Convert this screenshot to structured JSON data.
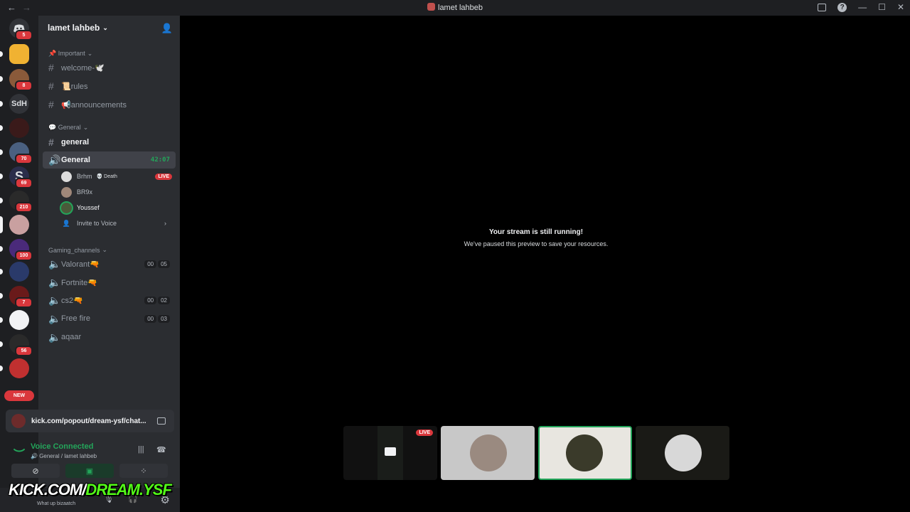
{
  "window": {
    "title": "lamet lahbeb",
    "back": "←",
    "forward": "→",
    "minimize": "—",
    "maximize": "☐",
    "close": "✕"
  },
  "rail": {
    "home_badge": "5",
    "servers": [
      {
        "label": "",
        "badge": "",
        "color": "#f0b232"
      },
      {
        "label": "",
        "badge": "8",
        "color": "#8a5a3a"
      },
      {
        "label": "SdH",
        "badge": "",
        "color": "#313338"
      },
      {
        "label": "",
        "badge": "",
        "color": "#3a1a1a"
      },
      {
        "label": "",
        "badge": "70",
        "color": "#4a6080"
      },
      {
        "label": "S",
        "badge": "69",
        "color": "#2b2d4a"
      },
      {
        "label": "",
        "badge": "210",
        "color": "#2a2a2a"
      },
      {
        "label": "",
        "badge": "",
        "color": "#c9a0a0"
      },
      {
        "label": "",
        "badge": "100",
        "color": "#4a2a7a"
      },
      {
        "label": "",
        "badge": "",
        "color": "#2a3a6a"
      },
      {
        "label": "",
        "badge": "7",
        "color": "#6a1a1a"
      },
      {
        "label": "",
        "badge": "",
        "color": "#f2f3f5"
      },
      {
        "label": "",
        "badge": "56",
        "color": "#2a2a2a"
      },
      {
        "label": "",
        "badge": "",
        "color": "#c03030"
      }
    ],
    "new_label": "NEW"
  },
  "guild": {
    "name": "lamet lahbeb"
  },
  "categories": {
    "important": "📌 Important",
    "general": "💬 General",
    "gaming": "Gaming_channels"
  },
  "channels": {
    "welcome": "welcome-🕊️",
    "rules": "📜rules",
    "announcements": "📢announcements",
    "general_text": "general",
    "general_voice": "General",
    "voice_timer": "42:07",
    "valorant": "Valorant🔫",
    "fortnite": "Fortnite🔫",
    "cs2": "cs2🔫",
    "freefire": "Free fire",
    "aqaar": "aqaar",
    "valorant_counts": [
      "00",
      "05"
    ],
    "cs2_counts": [
      "00",
      "02"
    ],
    "freefire_counts": [
      "00",
      "03"
    ]
  },
  "voice_users": [
    {
      "name": "Brhm",
      "activity": "💀 Death",
      "live": "LIVE"
    },
    {
      "name": "BR9x"
    },
    {
      "name": "Youssef"
    }
  ],
  "invite": "Invite to Voice",
  "popout": {
    "url": "kick.com/popout/dream-ysf/chat..."
  },
  "voice_panel": {
    "status": "Voice Connected",
    "channel": "General / lamet lahbeb"
  },
  "user_panel": {
    "status": "What up bizaatch"
  },
  "watermark": {
    "white": "KICK.COM/",
    "green": "DREAM.YSF"
  },
  "stage": {
    "title": "Your stream is still running!",
    "subtitle": "We've paused this preview to save your resources.",
    "live_tile": "LIVE"
  }
}
